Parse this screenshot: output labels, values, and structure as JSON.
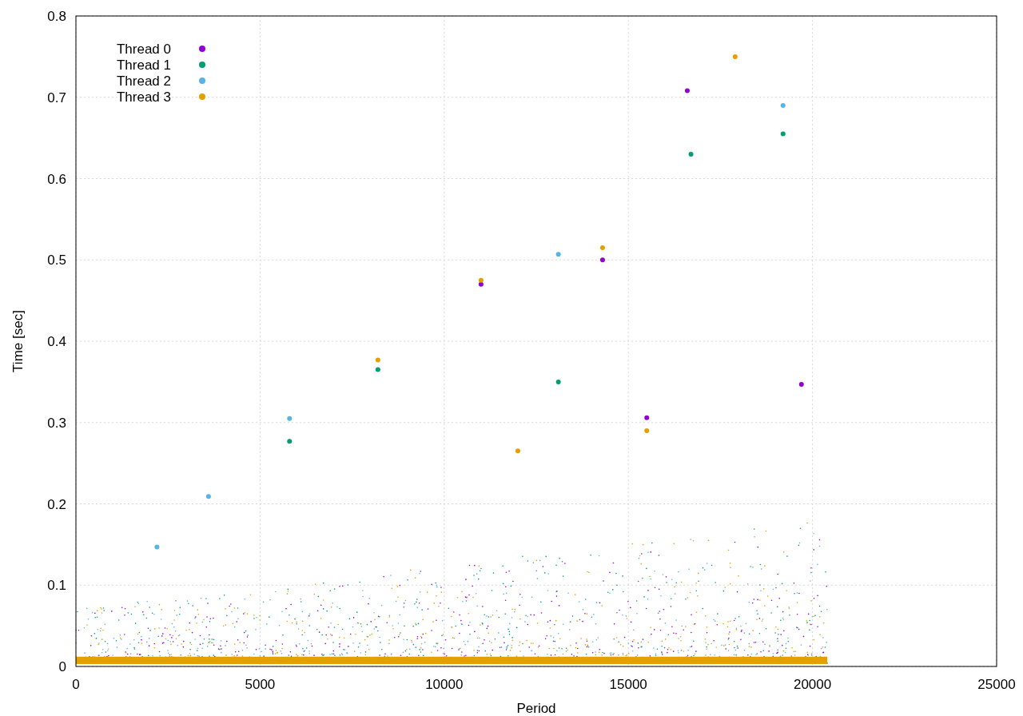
{
  "chart_data": {
    "type": "scatter",
    "grid": true,
    "legend": "upper left",
    "xlabel": "Period",
    "ylabel": "Time [sec]",
    "xlim": [
      0,
      25000
    ],
    "ylim": [
      0,
      0.8
    ],
    "xticks": [
      0,
      5000,
      10000,
      15000,
      20000,
      25000
    ],
    "yticks": [
      0,
      0.1,
      0.2,
      0.3,
      0.4,
      0.5,
      0.6,
      0.7,
      0.8
    ],
    "series": [
      {
        "name": "Thread 0",
        "color": "#9400d3",
        "x": [
          16600,
          14300,
          11000,
          15500,
          19700
        ],
        "values": [
          0.708,
          0.5,
          0.47,
          0.306,
          0.347
        ]
      },
      {
        "name": "Thread 1",
        "color": "#009e73",
        "x": [
          16700,
          19200,
          8200,
          5800,
          13100
        ],
        "values": [
          0.63,
          0.655,
          0.365,
          0.277,
          0.35
        ]
      },
      {
        "name": "Thread 2",
        "color": "#56b4e9",
        "x": [
          13100,
          19200,
          5800,
          3600,
          2200
        ],
        "values": [
          0.507,
          0.69,
          0.305,
          0.209,
          0.147
        ]
      },
      {
        "name": "Thread 3",
        "color": "#e69f00",
        "x": [
          17900,
          8200,
          11000,
          14300,
          15500,
          12000
        ],
        "values": [
          0.75,
          0.377,
          0.475,
          0.515,
          0.29,
          0.265
        ]
      }
    ]
  }
}
